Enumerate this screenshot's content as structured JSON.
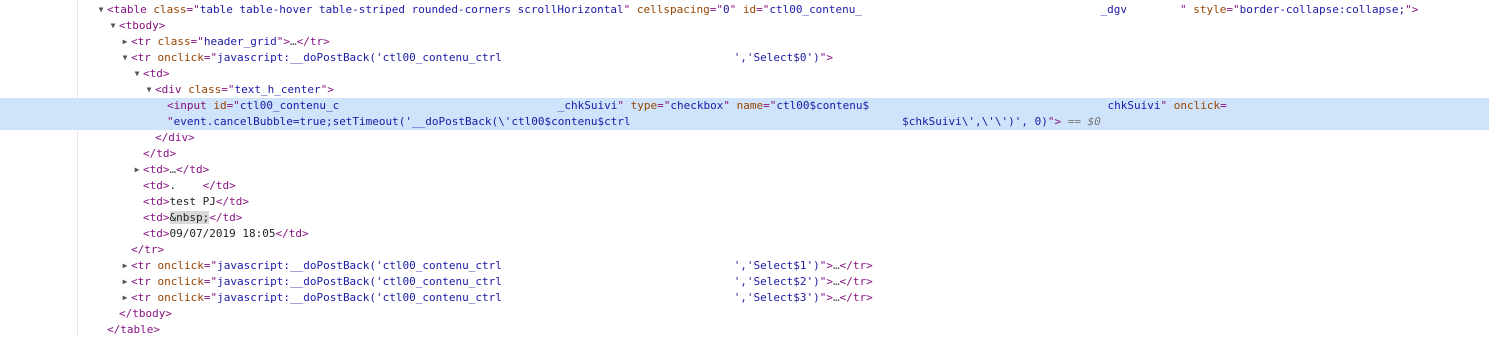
{
  "lines": [
    {
      "indent": 0,
      "toggle": "open",
      "segs": [
        [
          "t",
          "<table"
        ],
        [
          "s",
          " "
        ],
        [
          "a",
          "class"
        ],
        [
          "t",
          "=\""
        ],
        [
          "v",
          "table table-hover table-striped rounded-corners scrollHorizontal"
        ],
        [
          "t",
          "\""
        ],
        [
          "s",
          " "
        ],
        [
          "a",
          "cellspacing"
        ],
        [
          "t",
          "=\""
        ],
        [
          "v",
          "0"
        ],
        [
          "t",
          "\""
        ],
        [
          "s",
          " "
        ],
        [
          "a",
          "id"
        ],
        [
          "t",
          "=\""
        ],
        [
          "v",
          "ctl00_contenu_"
        ],
        [
          "gap",
          "                                    "
        ],
        [
          "v",
          "_dgv"
        ],
        [
          "gap",
          "        "
        ],
        [
          "t",
          "\""
        ],
        [
          "s",
          " "
        ],
        [
          "a",
          "style"
        ],
        [
          "t",
          "=\""
        ],
        [
          "v",
          "border-collapse:collapse;"
        ],
        [
          "t",
          "\">"
        ]
      ]
    },
    {
      "indent": 1,
      "toggle": "open",
      "segs": [
        [
          "t",
          "<tbody>"
        ]
      ]
    },
    {
      "indent": 2,
      "toggle": "closed",
      "segs": [
        [
          "t",
          "<tr"
        ],
        [
          "s",
          " "
        ],
        [
          "a",
          "class"
        ],
        [
          "t",
          "=\""
        ],
        [
          "v",
          "header_grid"
        ],
        [
          "t",
          "\">"
        ],
        [
          "e",
          "…"
        ],
        [
          "t",
          "</tr>"
        ]
      ]
    },
    {
      "indent": 2,
      "toggle": "open",
      "segs": [
        [
          "t",
          "<tr"
        ],
        [
          "s",
          " "
        ],
        [
          "a",
          "onclick"
        ],
        [
          "t",
          "=\""
        ],
        [
          "v",
          "javascript:__doPostBack('ctl00_contenu_ctrl"
        ],
        [
          "gap",
          "                                   "
        ],
        [
          "v",
          "','Select$0')"
        ],
        [
          "t",
          "\">"
        ]
      ]
    },
    {
      "indent": 3,
      "toggle": "open",
      "segs": [
        [
          "t",
          "<td>"
        ]
      ]
    },
    {
      "indent": 4,
      "toggle": "open",
      "segs": [
        [
          "t",
          "<div"
        ],
        [
          "s",
          " "
        ],
        [
          "a",
          "class"
        ],
        [
          "t",
          "=\""
        ],
        [
          "v",
          "text_h_center"
        ],
        [
          "t",
          "\">"
        ]
      ]
    },
    {
      "indent": 5,
      "toggle": "",
      "sel": true,
      "segs": [
        [
          "t",
          "<input"
        ],
        [
          "s",
          " "
        ],
        [
          "a",
          "id"
        ],
        [
          "t",
          "=\""
        ],
        [
          "v",
          "ctl00_contenu_c"
        ],
        [
          "gap",
          "                                 "
        ],
        [
          "v",
          "_chkSuivi"
        ],
        [
          "t",
          "\""
        ],
        [
          "s",
          " "
        ],
        [
          "a",
          "type"
        ],
        [
          "t",
          "=\""
        ],
        [
          "v",
          "checkbox"
        ],
        [
          "t",
          "\""
        ],
        [
          "s",
          " "
        ],
        [
          "a",
          "name"
        ],
        [
          "t",
          "=\""
        ],
        [
          "v",
          "ctl00$contenu$"
        ],
        [
          "gap",
          "                                    "
        ],
        [
          "v",
          "chkSuivi"
        ],
        [
          "t",
          "\""
        ],
        [
          "s",
          " "
        ],
        [
          "a",
          "onclick"
        ],
        [
          "t",
          "="
        ]
      ]
    },
    {
      "indent": 5,
      "toggle": "",
      "sel": true,
      "segs": [
        [
          "t",
          "\""
        ],
        [
          "v",
          "event.cancelBubble=true;setTimeout('__doPostBack(\\'ctl00$contenu$ctrl"
        ],
        [
          "gap",
          "                                         "
        ],
        [
          "v",
          "$chkSuivi\\',\\'\\')', 0)"
        ],
        [
          "t",
          "\">"
        ],
        [
          "s",
          " "
        ],
        [
          "d",
          "== $0"
        ]
      ]
    },
    {
      "indent": 4,
      "toggle": "",
      "segs": [
        [
          "t",
          "</div>"
        ]
      ]
    },
    {
      "indent": 3,
      "toggle": "",
      "segs": [
        [
          "t",
          "</td>"
        ]
      ]
    },
    {
      "indent": 3,
      "toggle": "closed",
      "segs": [
        [
          "t",
          "<td>"
        ],
        [
          "e",
          "…"
        ],
        [
          "t",
          "</td>"
        ]
      ]
    },
    {
      "indent": 3,
      "toggle": "",
      "segs": [
        [
          "t",
          "<td>"
        ],
        [
          "x",
          "."
        ],
        [
          "gap",
          "    "
        ],
        [
          "t",
          "</td>"
        ]
      ]
    },
    {
      "indent": 3,
      "toggle": "",
      "segs": [
        [
          "t",
          "<td>"
        ],
        [
          "x",
          "test PJ"
        ],
        [
          "t",
          "</td>"
        ]
      ]
    },
    {
      "indent": 3,
      "toggle": "",
      "segs": [
        [
          "t",
          "<td>"
        ],
        [
          "h",
          "&nbsp;"
        ],
        [
          "t",
          "</td>"
        ]
      ]
    },
    {
      "indent": 3,
      "toggle": "",
      "segs": [
        [
          "t",
          "<td>"
        ],
        [
          "x",
          "09/07/2019 18:05"
        ],
        [
          "t",
          "</td>"
        ]
      ]
    },
    {
      "indent": 2,
      "toggle": "",
      "segs": [
        [
          "t",
          "</tr>"
        ]
      ]
    },
    {
      "indent": 2,
      "toggle": "closed",
      "segs": [
        [
          "t",
          "<tr"
        ],
        [
          "s",
          " "
        ],
        [
          "a",
          "onclick"
        ],
        [
          "t",
          "=\""
        ],
        [
          "v",
          "javascript:__doPostBack('ctl00_contenu_ctrl"
        ],
        [
          "gap",
          "                                   "
        ],
        [
          "v",
          "','Select$1')"
        ],
        [
          "t",
          "\">"
        ],
        [
          "e",
          "…"
        ],
        [
          "t",
          "</tr>"
        ]
      ]
    },
    {
      "indent": 2,
      "toggle": "closed",
      "segs": [
        [
          "t",
          "<tr"
        ],
        [
          "s",
          " "
        ],
        [
          "a",
          "onclick"
        ],
        [
          "t",
          "=\""
        ],
        [
          "v",
          "javascript:__doPostBack('ctl00_contenu_ctrl"
        ],
        [
          "gap",
          "                                   "
        ],
        [
          "v",
          "','Select$2')"
        ],
        [
          "t",
          "\">"
        ],
        [
          "e",
          "…"
        ],
        [
          "t",
          "</tr>"
        ]
      ]
    },
    {
      "indent": 2,
      "toggle": "closed",
      "segs": [
        [
          "t",
          "<tr"
        ],
        [
          "s",
          " "
        ],
        [
          "a",
          "onclick"
        ],
        [
          "t",
          "=\""
        ],
        [
          "v",
          "javascript:__doPostBack('ctl00_contenu_ctrl"
        ],
        [
          "gap",
          "                                   "
        ],
        [
          "v",
          "','Select$3')"
        ],
        [
          "t",
          "\">"
        ],
        [
          "e",
          "…"
        ],
        [
          "t",
          "</tr>"
        ]
      ]
    },
    {
      "indent": 1,
      "toggle": "",
      "segs": [
        [
          "t",
          "</tbody>"
        ]
      ]
    },
    {
      "indent": 0,
      "toggle": "",
      "segs": [
        [
          "t",
          "</table>"
        ]
      ]
    }
  ]
}
